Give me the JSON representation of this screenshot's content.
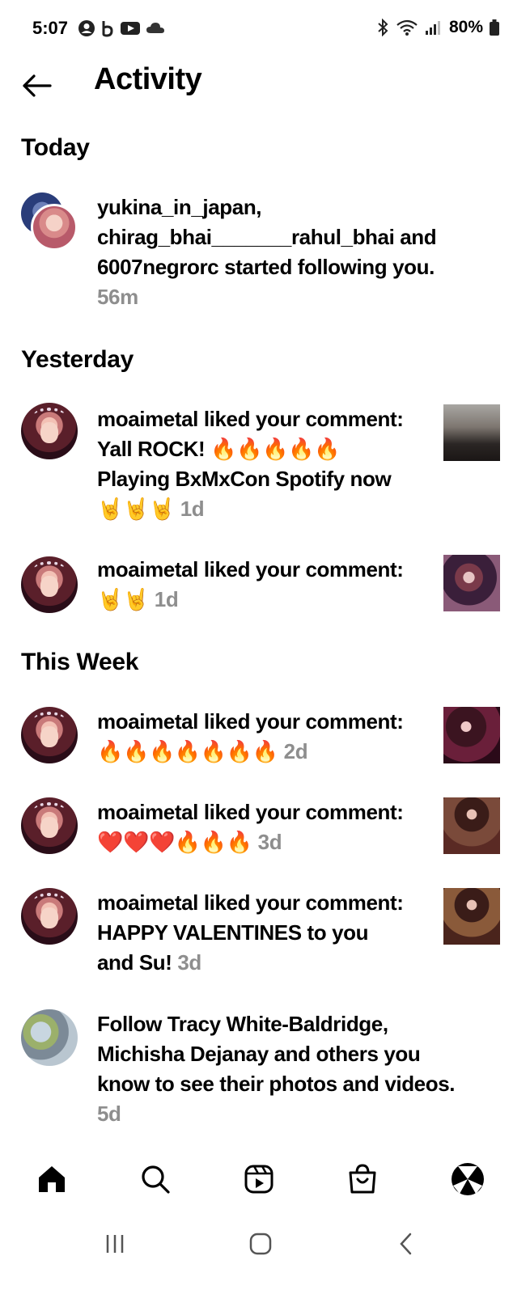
{
  "status_bar": {
    "time": "5:07",
    "battery": "80%",
    "icons": [
      "account-icon",
      "b-icon",
      "youtube-icon",
      "cloud-icon",
      "bluetooth-icon",
      "wifi-icon",
      "signal-icon",
      "battery-icon"
    ]
  },
  "header": {
    "title": "Activity"
  },
  "sections": {
    "today": "Today",
    "yesterday": "Yesterday",
    "this_week": "This Week"
  },
  "notifications": [
    {
      "user": "yukina_in_japan,",
      "line2": "chirag_bhai_______rahul_bhai and",
      "line3": "6007negrorc started following you.",
      "time": "56m"
    },
    {
      "user": "moaimetal",
      "action": " liked your comment:",
      "text": "Yall ROCK! 🔥🔥🔥🔥🔥",
      "text2": "Playing BxMxCon Spotify now",
      "text3": "🤘🤘🤘 ",
      "time": "1d"
    },
    {
      "user": "moaimetal",
      "action": " liked your comment:",
      "text": "🤘🤘 ",
      "time": "1d"
    },
    {
      "user": "moaimetal",
      "action": " liked your comment:",
      "text": "🔥🔥🔥🔥🔥🔥🔥 ",
      "time": "2d"
    },
    {
      "user": "moaimetal",
      "action": " liked your comment:",
      "text": "❤️❤️❤️🔥🔥🔥 ",
      "time": "3d"
    },
    {
      "user": "moaimetal",
      "action": " liked your comment:",
      "text": "HAPPY VALENTINES to you",
      "text2": "and Su! ",
      "time": "3d"
    },
    {
      "line1": "Follow Tracy White-Baldridge,",
      "line2": "Michisha Dejanay and others you",
      "line3": "know to see their photos and videos.",
      "time": "5d"
    }
  ],
  "tabbar": [
    "home-icon",
    "search-icon",
    "reels-icon",
    "shop-icon",
    "profile-icon"
  ],
  "system_nav": [
    "recents-icon",
    "home-circle-icon",
    "back-chevron-icon"
  ]
}
